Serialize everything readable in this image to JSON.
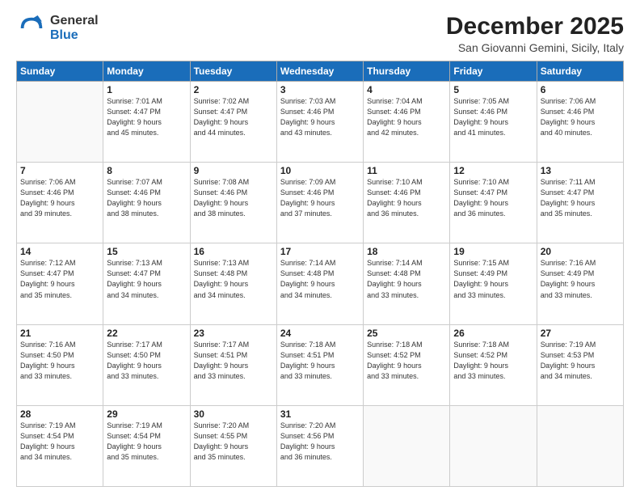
{
  "header": {
    "logo_general": "General",
    "logo_blue": "Blue",
    "month_title": "December 2025",
    "location": "San Giovanni Gemini, Sicily, Italy"
  },
  "weekdays": [
    "Sunday",
    "Monday",
    "Tuesday",
    "Wednesday",
    "Thursday",
    "Friday",
    "Saturday"
  ],
  "weeks": [
    [
      {
        "day": "",
        "info": ""
      },
      {
        "day": "1",
        "info": "Sunrise: 7:01 AM\nSunset: 4:47 PM\nDaylight: 9 hours\nand 45 minutes."
      },
      {
        "day": "2",
        "info": "Sunrise: 7:02 AM\nSunset: 4:47 PM\nDaylight: 9 hours\nand 44 minutes."
      },
      {
        "day": "3",
        "info": "Sunrise: 7:03 AM\nSunset: 4:46 PM\nDaylight: 9 hours\nand 43 minutes."
      },
      {
        "day": "4",
        "info": "Sunrise: 7:04 AM\nSunset: 4:46 PM\nDaylight: 9 hours\nand 42 minutes."
      },
      {
        "day": "5",
        "info": "Sunrise: 7:05 AM\nSunset: 4:46 PM\nDaylight: 9 hours\nand 41 minutes."
      },
      {
        "day": "6",
        "info": "Sunrise: 7:06 AM\nSunset: 4:46 PM\nDaylight: 9 hours\nand 40 minutes."
      }
    ],
    [
      {
        "day": "7",
        "info": "Sunrise: 7:06 AM\nSunset: 4:46 PM\nDaylight: 9 hours\nand 39 minutes."
      },
      {
        "day": "8",
        "info": "Sunrise: 7:07 AM\nSunset: 4:46 PM\nDaylight: 9 hours\nand 38 minutes."
      },
      {
        "day": "9",
        "info": "Sunrise: 7:08 AM\nSunset: 4:46 PM\nDaylight: 9 hours\nand 38 minutes."
      },
      {
        "day": "10",
        "info": "Sunrise: 7:09 AM\nSunset: 4:46 PM\nDaylight: 9 hours\nand 37 minutes."
      },
      {
        "day": "11",
        "info": "Sunrise: 7:10 AM\nSunset: 4:46 PM\nDaylight: 9 hours\nand 36 minutes."
      },
      {
        "day": "12",
        "info": "Sunrise: 7:10 AM\nSunset: 4:47 PM\nDaylight: 9 hours\nand 36 minutes."
      },
      {
        "day": "13",
        "info": "Sunrise: 7:11 AM\nSunset: 4:47 PM\nDaylight: 9 hours\nand 35 minutes."
      }
    ],
    [
      {
        "day": "14",
        "info": "Sunrise: 7:12 AM\nSunset: 4:47 PM\nDaylight: 9 hours\nand 35 minutes."
      },
      {
        "day": "15",
        "info": "Sunrise: 7:13 AM\nSunset: 4:47 PM\nDaylight: 9 hours\nand 34 minutes."
      },
      {
        "day": "16",
        "info": "Sunrise: 7:13 AM\nSunset: 4:48 PM\nDaylight: 9 hours\nand 34 minutes."
      },
      {
        "day": "17",
        "info": "Sunrise: 7:14 AM\nSunset: 4:48 PM\nDaylight: 9 hours\nand 34 minutes."
      },
      {
        "day": "18",
        "info": "Sunrise: 7:14 AM\nSunset: 4:48 PM\nDaylight: 9 hours\nand 33 minutes."
      },
      {
        "day": "19",
        "info": "Sunrise: 7:15 AM\nSunset: 4:49 PM\nDaylight: 9 hours\nand 33 minutes."
      },
      {
        "day": "20",
        "info": "Sunrise: 7:16 AM\nSunset: 4:49 PM\nDaylight: 9 hours\nand 33 minutes."
      }
    ],
    [
      {
        "day": "21",
        "info": "Sunrise: 7:16 AM\nSunset: 4:50 PM\nDaylight: 9 hours\nand 33 minutes."
      },
      {
        "day": "22",
        "info": "Sunrise: 7:17 AM\nSunset: 4:50 PM\nDaylight: 9 hours\nand 33 minutes."
      },
      {
        "day": "23",
        "info": "Sunrise: 7:17 AM\nSunset: 4:51 PM\nDaylight: 9 hours\nand 33 minutes."
      },
      {
        "day": "24",
        "info": "Sunrise: 7:18 AM\nSunset: 4:51 PM\nDaylight: 9 hours\nand 33 minutes."
      },
      {
        "day": "25",
        "info": "Sunrise: 7:18 AM\nSunset: 4:52 PM\nDaylight: 9 hours\nand 33 minutes."
      },
      {
        "day": "26",
        "info": "Sunrise: 7:18 AM\nSunset: 4:52 PM\nDaylight: 9 hours\nand 33 minutes."
      },
      {
        "day": "27",
        "info": "Sunrise: 7:19 AM\nSunset: 4:53 PM\nDaylight: 9 hours\nand 34 minutes."
      }
    ],
    [
      {
        "day": "28",
        "info": "Sunrise: 7:19 AM\nSunset: 4:54 PM\nDaylight: 9 hours\nand 34 minutes."
      },
      {
        "day": "29",
        "info": "Sunrise: 7:19 AM\nSunset: 4:54 PM\nDaylight: 9 hours\nand 35 minutes."
      },
      {
        "day": "30",
        "info": "Sunrise: 7:20 AM\nSunset: 4:55 PM\nDaylight: 9 hours\nand 35 minutes."
      },
      {
        "day": "31",
        "info": "Sunrise: 7:20 AM\nSunset: 4:56 PM\nDaylight: 9 hours\nand 36 minutes."
      },
      {
        "day": "",
        "info": ""
      },
      {
        "day": "",
        "info": ""
      },
      {
        "day": "",
        "info": ""
      }
    ]
  ]
}
